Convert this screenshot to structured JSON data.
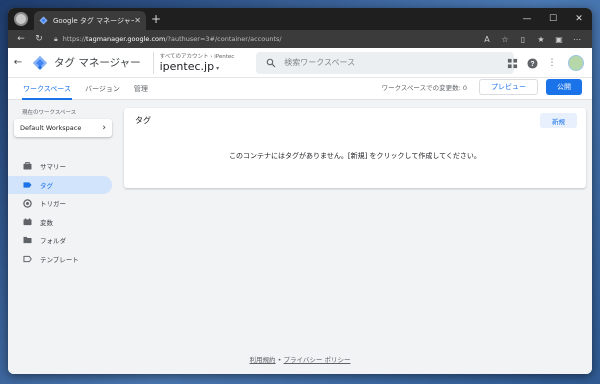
{
  "browser": {
    "tab_title": "Google タグ マネージャー",
    "tab_close": "✕",
    "new_tab": "+",
    "url_prefix": "https://",
    "url_host": "tagmanager.google.com",
    "url_path": "/?authuser=3#/container/accounts/",
    "window_controls": [
      "—",
      "☐",
      "✕"
    ]
  },
  "header": {
    "product_name": "タグ マネージャー",
    "breadcrumb": "すべてのアカウント › iPentec",
    "container_name": "ipentec.jp",
    "container_caret": "▾",
    "search_placeholder": "検索ワークスペース"
  },
  "subnav": {
    "tabs": [
      {
        "label": "ワークスペース",
        "active": true
      },
      {
        "label": "バージョン",
        "active": false
      },
      {
        "label": "管理",
        "active": false
      }
    ],
    "changes_text": "ワークスペースでの変更数: 0",
    "preview_label": "プレビュー",
    "submit_label": "公開"
  },
  "sidebar": {
    "workspace_label": "現在のワークスペース",
    "workspace_name": "Default Workspace",
    "workspace_arrow": "›",
    "items": [
      {
        "label": "サマリー",
        "icon": "briefcase-icon",
        "active": false
      },
      {
        "label": "タグ",
        "icon": "tag-icon",
        "active": true
      },
      {
        "label": "トリガー",
        "icon": "trigger-icon",
        "active": false
      },
      {
        "label": "変数",
        "icon": "variables-icon",
        "active": false
      },
      {
        "label": "フォルダ",
        "icon": "folder-icon",
        "active": false
      },
      {
        "label": "テンプレート",
        "icon": "template-icon",
        "active": false
      }
    ]
  },
  "main": {
    "card_title": "タグ",
    "new_button": "新規",
    "empty_message": "このコンテナにはタグがありません。[新規] をクリックして作成してください。"
  },
  "footer": {
    "terms": "利用規約",
    "separator": " • ",
    "privacy": "プライバシー ポリシー"
  },
  "colors": {
    "accent": "#1a73e8",
    "active_nav_bg": "#d2e3fc",
    "page_bg": "#f1f3f4"
  }
}
